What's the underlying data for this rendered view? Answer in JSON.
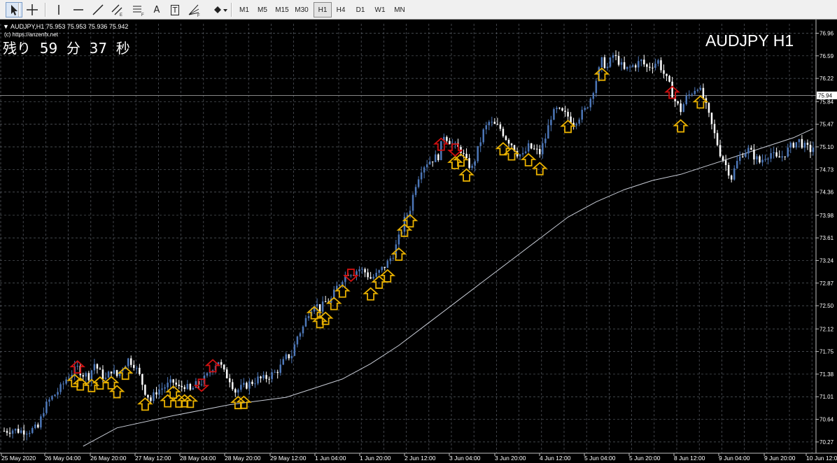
{
  "toolbar": {
    "tools": [
      {
        "name": "cursor-icon",
        "active": true
      },
      {
        "name": "crosshair-icon",
        "active": false
      },
      {
        "name": "vertical-line-icon",
        "active": false
      },
      {
        "name": "horizontal-line-icon",
        "active": false
      },
      {
        "name": "trendline-icon",
        "active": false
      },
      {
        "name": "equidistant-channel-icon",
        "active": false
      },
      {
        "name": "fibonacci-retracement-icon",
        "active": false
      },
      {
        "name": "text-icon",
        "active": false
      },
      {
        "name": "text-label-icon",
        "active": false
      },
      {
        "name": "fibonacci-fan-icon",
        "active": false
      },
      {
        "name": "arrows-dropdown-icon",
        "active": false
      }
    ],
    "text_tool_label": "A",
    "label_tool_label": "T",
    "timeframes": [
      "M1",
      "M5",
      "M15",
      "M30",
      "H1",
      "H4",
      "D1",
      "W1",
      "MN"
    ],
    "active_timeframe": "H1"
  },
  "header": {
    "symbol_info": "AUDJPY,H1  75.953 75.953 75.936 75.942",
    "copyright": "(c) https://anzenfx.net",
    "countdown": "残り  59  分  37  秒",
    "chart_title": "AUDJPY H1"
  },
  "colors": {
    "background": "#000000",
    "grid": "#5a5f66",
    "bull_candle": "#4d77b8",
    "bear_candle": "#ffffff",
    "ma_line": "#c8ccd6",
    "price_line": "#9a9a9a",
    "buy_arrow": "#e8b000",
    "sell_arrow": "#d01010"
  },
  "chart_data": {
    "type": "candlestick",
    "symbol": "AUDJPY",
    "timeframe": "H1",
    "current_price": 75.942,
    "ohlc": {
      "open": 75.953,
      "high": 75.953,
      "low": 75.936,
      "close": 75.942
    },
    "y_ticks": [
      "76.96",
      "76.59",
      "76.22",
      "75.84",
      "75.47",
      "75.10",
      "74.73",
      "74.36",
      "73.98",
      "73.61",
      "73.24",
      "72.87",
      "72.50",
      "72.12",
      "71.75",
      "71.38",
      "71.01",
      "70.64",
      "70.27"
    ],
    "current_price_label": "75.94",
    "ylim": [
      70.2,
      77.0
    ],
    "x_ticks": [
      "25 May 2020",
      "26 May 04:00",
      "26 May 20:00",
      "27 May 12:00",
      "28 May 04:00",
      "28 May 20:00",
      "29 May 12:00",
      "1 Jun 04:00",
      "1 Jun 20:00",
      "2 Jun 12:00",
      "3 Jun 04:00",
      "3 Jun 20:00",
      "4 Jun 12:00",
      "5 Jun 04:00",
      "5 Jun 20:00",
      "8 Jun 12:00",
      "9 Jun 04:00",
      "9 Jun 20:00",
      "10 Jun 12:00"
    ],
    "close_path": [
      [
        0,
        70.45
      ],
      [
        3,
        70.47
      ],
      [
        6,
        70.45
      ],
      [
        9,
        70.46
      ],
      [
        12,
        70.5
      ],
      [
        14,
        70.8
      ],
      [
        16,
        70.95
      ],
      [
        18,
        71.05
      ],
      [
        20,
        71.15
      ],
      [
        22,
        71.3
      ],
      [
        24,
        71.4
      ],
      [
        26,
        71.48
      ],
      [
        28,
        71.38
      ],
      [
        30,
        71.35
      ],
      [
        32,
        71.55
      ],
      [
        34,
        71.4
      ],
      [
        36,
        71.3
      ],
      [
        38,
        71.45
      ],
      [
        40,
        71.35
      ],
      [
        42,
        71.5
      ],
      [
        44,
        71.62
      ],
      [
        46,
        71.55
      ],
      [
        48,
        71.35
      ],
      [
        50,
        71.1
      ],
      [
        52,
        70.95
      ],
      [
        54,
        71.1
      ],
      [
        56,
        71.15
      ],
      [
        58,
        71.2
      ],
      [
        60,
        71.25
      ],
      [
        62,
        71.15
      ],
      [
        64,
        71.2
      ],
      [
        66,
        71.1
      ],
      [
        68,
        71.2
      ],
      [
        70,
        71.25
      ],
      [
        72,
        71.35
      ],
      [
        74,
        71.5
      ],
      [
        76,
        71.6
      ],
      [
        78,
        71.4
      ],
      [
        80,
        71.3
      ],
      [
        82,
        71.1
      ],
      [
        84,
        71.15
      ],
      [
        86,
        71.2
      ],
      [
        88,
        71.25
      ],
      [
        90,
        71.3
      ],
      [
        92,
        71.3
      ],
      [
        94,
        71.35
      ],
      [
        96,
        71.4
      ],
      [
        98,
        71.5
      ],
      [
        100,
        71.65
      ],
      [
        102,
        71.7
      ],
      [
        104,
        72.0
      ],
      [
        106,
        72.15
      ],
      [
        108,
        72.4
      ],
      [
        110,
        72.55
      ],
      [
        112,
        72.45
      ],
      [
        114,
        72.55
      ],
      [
        116,
        72.6
      ],
      [
        118,
        72.8
      ],
      [
        120,
        72.95
      ],
      [
        122,
        73.05
      ],
      [
        124,
        73.05
      ],
      [
        126,
        73.1
      ],
      [
        128,
        73.05
      ],
      [
        130,
        72.95
      ],
      [
        132,
        73.0
      ],
      [
        134,
        73.1
      ],
      [
        136,
        73.2
      ],
      [
        138,
        73.35
      ],
      [
        140,
        73.6
      ],
      [
        142,
        73.9
      ],
      [
        144,
        74.1
      ],
      [
        146,
        74.5
      ],
      [
        148,
        74.75
      ],
      [
        150,
        74.85
      ],
      [
        152,
        74.9
      ],
      [
        154,
        74.95
      ],
      [
        156,
        75.3
      ],
      [
        158,
        75.2
      ],
      [
        160,
        75.1
      ],
      [
        162,
        75.05
      ],
      [
        164,
        74.85
      ],
      [
        166,
        74.75
      ],
      [
        168,
        75.05
      ],
      [
        170,
        75.35
      ],
      [
        172,
        75.5
      ],
      [
        174,
        75.45
      ],
      [
        176,
        75.4
      ],
      [
        178,
        75.25
      ],
      [
        180,
        75.15
      ],
      [
        182,
        75.0
      ],
      [
        184,
        74.95
      ],
      [
        186,
        75.1
      ],
      [
        188,
        75.05
      ],
      [
        190,
        75.0
      ],
      [
        192,
        75.25
      ],
      [
        194,
        75.6
      ],
      [
        196,
        75.7
      ],
      [
        198,
        75.65
      ],
      [
        200,
        75.6
      ],
      [
        202,
        75.5
      ],
      [
        204,
        75.6
      ],
      [
        206,
        75.7
      ],
      [
        208,
        75.9
      ],
      [
        210,
        76.2
      ],
      [
        212,
        76.5
      ],
      [
        214,
        76.4
      ],
      [
        216,
        76.6
      ],
      [
        218,
        76.5
      ],
      [
        220,
        76.35
      ],
      [
        222,
        76.4
      ],
      [
        224,
        76.45
      ],
      [
        226,
        76.5
      ],
      [
        228,
        76.4
      ],
      [
        230,
        76.45
      ],
      [
        232,
        76.5
      ],
      [
        234,
        76.3
      ],
      [
        236,
        76.1
      ],
      [
        238,
        75.85
      ],
      [
        240,
        75.7
      ],
      [
        242,
        75.9
      ],
      [
        244,
        76.0
      ],
      [
        246,
        76.1
      ],
      [
        248,
        75.9
      ],
      [
        250,
        75.6
      ],
      [
        252,
        75.3
      ],
      [
        254,
        75.0
      ],
      [
        256,
        74.8
      ],
      [
        258,
        74.6
      ],
      [
        260,
        74.85
      ],
      [
        262,
        75.0
      ],
      [
        264,
        75.05
      ],
      [
        266,
        74.95
      ],
      [
        268,
        74.85
      ],
      [
        270,
        74.95
      ],
      [
        272,
        75.0
      ],
      [
        274,
        74.9
      ],
      [
        276,
        74.95
      ],
      [
        278,
        75.05
      ],
      [
        280,
        75.15
      ],
      [
        282,
        75.2
      ],
      [
        284,
        75.1
      ],
      [
        286,
        75.05
      ],
      [
        287,
        75.1
      ]
    ],
    "ma_path": [
      [
        28,
        70.2
      ],
      [
        40,
        70.5
      ],
      [
        60,
        70.7
      ],
      [
        80,
        70.88
      ],
      [
        100,
        71.0
      ],
      [
        110,
        71.15
      ],
      [
        120,
        71.3
      ],
      [
        130,
        71.55
      ],
      [
        140,
        71.85
      ],
      [
        150,
        72.2
      ],
      [
        160,
        72.55
      ],
      [
        170,
        72.9
      ],
      [
        180,
        73.25
      ],
      [
        190,
        73.6
      ],
      [
        200,
        73.95
      ],
      [
        210,
        74.2
      ],
      [
        220,
        74.4
      ],
      [
        230,
        74.55
      ],
      [
        240,
        74.65
      ],
      [
        250,
        74.8
      ],
      [
        260,
        74.95
      ],
      [
        270,
        75.1
      ],
      [
        280,
        75.25
      ],
      [
        287,
        75.4
      ]
    ],
    "buy_arrow_bars": [
      25,
      27,
      31,
      34,
      38,
      40,
      43,
      50,
      58,
      60,
      62,
      64,
      66,
      83,
      85,
      110,
      112,
      114,
      117,
      120,
      130,
      133,
      136,
      140,
      142,
      144,
      160,
      162,
      164,
      177,
      180,
      186,
      190,
      200,
      212,
      240,
      247
    ],
    "sell_arrow_bars": [
      26,
      70,
      74,
      123,
      155,
      160,
      237
    ]
  }
}
